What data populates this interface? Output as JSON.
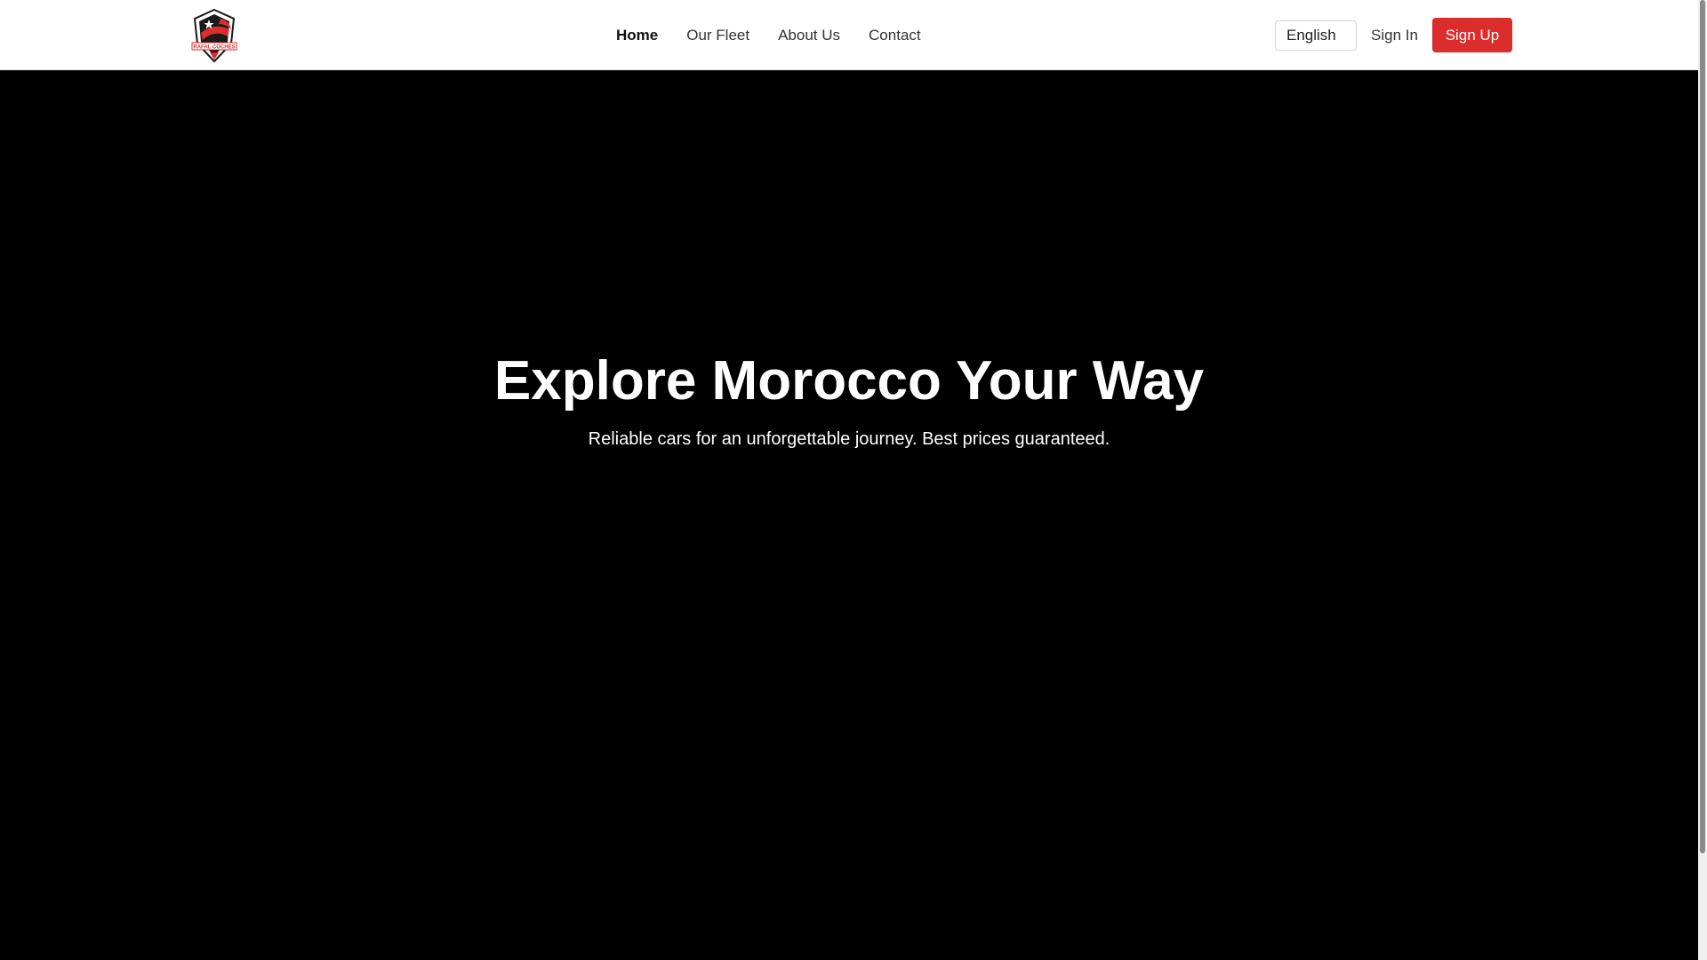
{
  "brand": {
    "logo_text": "RAFAL COCHES",
    "logo_colors": {
      "red": "#dc2d2d",
      "dark": "#1a1a1a"
    }
  },
  "nav": {
    "links": [
      {
        "label": "Home",
        "active": true
      },
      {
        "label": "Our Fleet",
        "active": false
      },
      {
        "label": "About Us",
        "active": false
      },
      {
        "label": "Contact",
        "active": false
      }
    ]
  },
  "controls": {
    "language": "English",
    "sign_in": "Sign In",
    "sign_up": "Sign Up",
    "accent_color": "#dc2d2d"
  },
  "hero": {
    "title": "Explore Morocco Your Way",
    "subtitle": "Reliable cars for an unforgettable journey. Best prices guaranteed.",
    "background_color": "#000000"
  }
}
